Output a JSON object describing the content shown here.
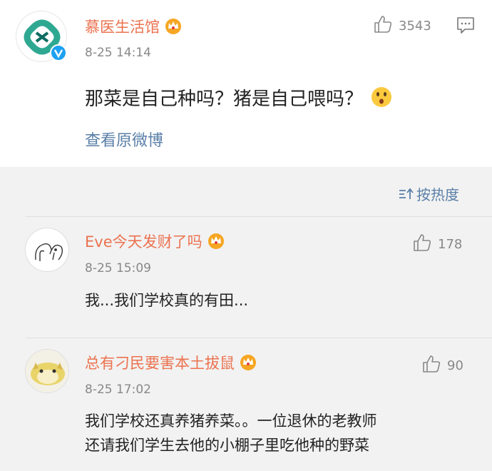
{
  "post": {
    "author": "慕医生活馆",
    "time": "8-25 14:14",
    "likes": "3543",
    "text": "那菜是自己种吗？猪是自己喂吗？",
    "view_original": "查看原微博"
  },
  "sort_label": "按热度",
  "comments": [
    {
      "author": "Eve今天发财了吗",
      "time": "8-25 15:09",
      "likes": "178",
      "text": "我...我们学校真的有田..."
    },
    {
      "author": "总有刁民要害本土拔鼠",
      "time": "8-25 17:02",
      "likes": "90",
      "text_line1": "我们学校还真养猪养菜。。一位退休的老教师",
      "text_line2": "还请我们学生去他的小棚子里吃他种的野菜"
    }
  ],
  "colors": {
    "name": "#eb7350",
    "link": "#5a7fa7",
    "meta": "#888888"
  },
  "icons": [
    "verified-badge-icon",
    "crown-icon",
    "thumbs-up-icon",
    "comment-icon",
    "sort-icon",
    "surprised-emoji-icon"
  ]
}
